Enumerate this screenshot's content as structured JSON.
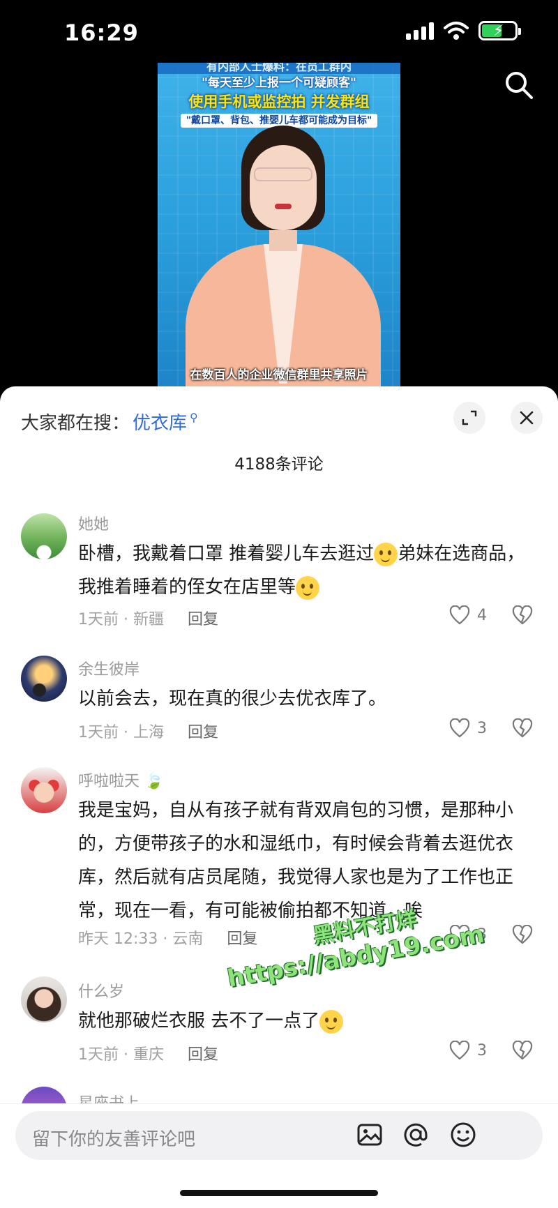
{
  "status_bar": {
    "time": "16:29"
  },
  "video": {
    "caption_top": "有内部人士爆料：在员工群内",
    "caption_line1": "\"每天至少上报一个可疑顾客\"",
    "caption_line2": "使用手机或监控拍 并发群组",
    "caption_line3": "\"戴口罩、背包、推婴儿车都可能成为目标\"",
    "lower_third": "在数百人的企业微信群里共享照片"
  },
  "comments_panel": {
    "trending_prefix": "大家都在搜：",
    "trending_keyword": "优衣库",
    "comment_count": "4188条评论"
  },
  "comments": [
    {
      "user": "她她",
      "text": "卧槽，我戴着口罩 推着婴儿车去逛过",
      "text_b": "弟妹在选商品，我推着睡着的侄女在店里等",
      "meta": "1天前 · 新疆",
      "reply": "回复",
      "likes": "4"
    },
    {
      "user": "余生彼岸",
      "text": "以前会去，现在真的很少去优衣库了。",
      "meta": "1天前 · 上海",
      "reply": "回复",
      "likes": "3"
    },
    {
      "user": "呼啦啦天",
      "text": "我是宝妈，自从有孩子就有背双肩包的习惯，是那种小的，方便带孩子的水和湿纸巾，有时候会背着去逛优衣库，然后就有店员尾随，我觉得人家也是为了工作也正常，现在一看，有可能被偷拍都不知道，唉",
      "meta": "昨天 12:33 · 云南",
      "reply": "回复",
      "likes": "3"
    },
    {
      "user": "什么岁",
      "text": "就他那破烂衣服 去不了一点了",
      "meta": "1天前 · 重庆",
      "reply": "回复",
      "likes": "3"
    }
  ],
  "partial_comment": {
    "user": "星座书上"
  },
  "watermark": {
    "line1": "黑料不打烊",
    "line2": "https://abdy19.com"
  },
  "composer": {
    "placeholder": "留下你的友善评论吧"
  },
  "colors": {
    "accent_blue": "#2f6bd9",
    "battery_green": "#30d158"
  }
}
